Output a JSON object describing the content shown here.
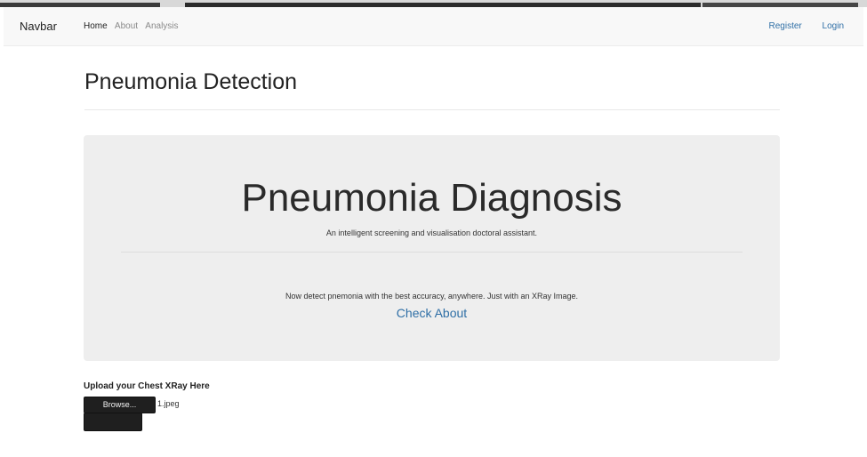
{
  "navbar": {
    "brand": "Navbar",
    "left_links": [
      "Home",
      "About",
      "Analysis"
    ],
    "right_links": [
      "Register",
      "Login"
    ]
  },
  "page": {
    "title": "Pneumonia Detection"
  },
  "jumbotron": {
    "title": "Pneumonia Diagnosis",
    "subtitle": "An intelligent screening and visualisation doctoral assistant.",
    "text": "Now detect pnemonia with the best accuracy, anywhere. Just with an XRay Image.",
    "link": "Check About"
  },
  "upload": {
    "label": "Upload your Chest XRay Here",
    "browse_label": "Browse...",
    "file_name": "1.jpeg"
  },
  "colors": {
    "link": "#2f6fa6",
    "jumbotron_bg": "#eeeeee",
    "button_bg": "#1f1f1f"
  }
}
